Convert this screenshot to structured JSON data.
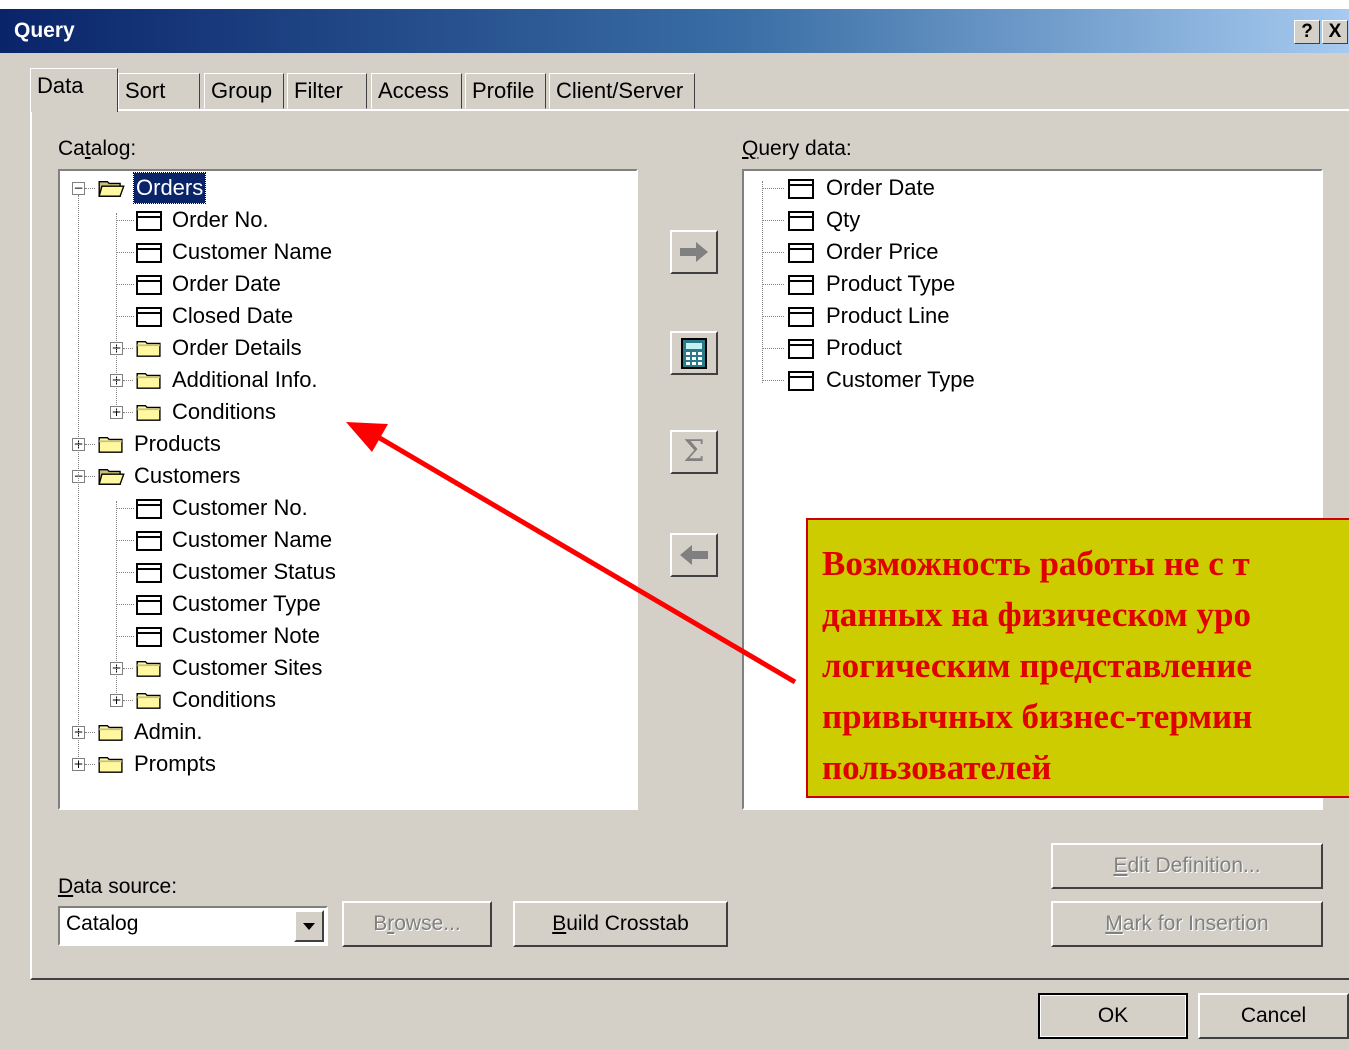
{
  "window": {
    "title": "Query",
    "help_button": "?",
    "close_button": "X"
  },
  "tabs": [
    {
      "label": "Data",
      "active": true
    },
    {
      "label": "Sort"
    },
    {
      "label": "Group"
    },
    {
      "label": "Filter"
    },
    {
      "label": "Access"
    },
    {
      "label": "Profile"
    },
    {
      "label": "Client/Server"
    }
  ],
  "catalog": {
    "label_pre": "Ca",
    "label_key": "t",
    "label_post": "alog:",
    "items": [
      {
        "label": "Orders",
        "type": "folder-open",
        "expander": "−",
        "selected": true
      },
      {
        "label": "Order No.",
        "type": "field"
      },
      {
        "label": "Customer Name",
        "type": "field"
      },
      {
        "label": "Order Date",
        "type": "field"
      },
      {
        "label": "Closed Date",
        "type": "field"
      },
      {
        "label": "Order Details",
        "type": "folder",
        "expander": "+"
      },
      {
        "label": "Additional Info.",
        "type": "folder",
        "expander": "+"
      },
      {
        "label": "Conditions",
        "type": "folder",
        "expander": "+"
      },
      {
        "label": "Products",
        "type": "folder",
        "expander": "+"
      },
      {
        "label": "Customers",
        "type": "folder-open",
        "expander": "−"
      },
      {
        "label": "Customer No.",
        "type": "field"
      },
      {
        "label": "Customer Name",
        "type": "field"
      },
      {
        "label": "Customer Status",
        "type": "field"
      },
      {
        "label": "Customer Type",
        "type": "field"
      },
      {
        "label": "Customer Note",
        "type": "field"
      },
      {
        "label": "Customer Sites",
        "type": "folder",
        "expander": "+"
      },
      {
        "label": "Conditions",
        "type": "folder",
        "expander": "+"
      },
      {
        "label": "Admin.",
        "type": "folder",
        "expander": "+"
      },
      {
        "label": "Prompts",
        "type": "folder",
        "expander": "+"
      }
    ]
  },
  "query_data": {
    "label_key": "Q",
    "label_post": "uery data:",
    "items": [
      {
        "label": "Order Date"
      },
      {
        "label": "Qty"
      },
      {
        "label": "Order Price"
      },
      {
        "label": "Product Type"
      },
      {
        "label": "Product Line"
      },
      {
        "label": "Product"
      },
      {
        "label": "Customer Type"
      }
    ]
  },
  "transfer_buttons": [
    {
      "name": "add-arrow-button",
      "icon": "arrow-right-icon",
      "glyph": "➡"
    },
    {
      "name": "calculation-button",
      "icon": "calculator-icon",
      "glyph": "▦"
    },
    {
      "name": "aggregate-button",
      "icon": "sigma-icon",
      "glyph": "Σ"
    },
    {
      "name": "remove-arrow-button",
      "icon": "arrow-left-icon",
      "glyph": "⬅"
    }
  ],
  "data_source": {
    "label_key": "D",
    "label_post": "ata source:",
    "value": "Catalog"
  },
  "buttons": {
    "browse_pre": "B",
    "browse_key": "r",
    "browse_post": "owse...",
    "build_key": "B",
    "build_post": "uild Crosstab",
    "edit_key": "E",
    "edit_post": "dit Definition...",
    "mark_key": "M",
    "mark_post": "ark for Insertion",
    "ok": "OK",
    "cancel": "Cancel"
  },
  "callout": {
    "text": "Возможность работы не с т\nданных на физическом уро\nлогическим представление\nпривычных бизнес-термин\nпользователей"
  },
  "colors": {
    "title_gradient_start": "#0a246a",
    "callout_fill": "#cccc00",
    "callout_text": "#e00000",
    "annotation_arrow": "#ff0000"
  }
}
